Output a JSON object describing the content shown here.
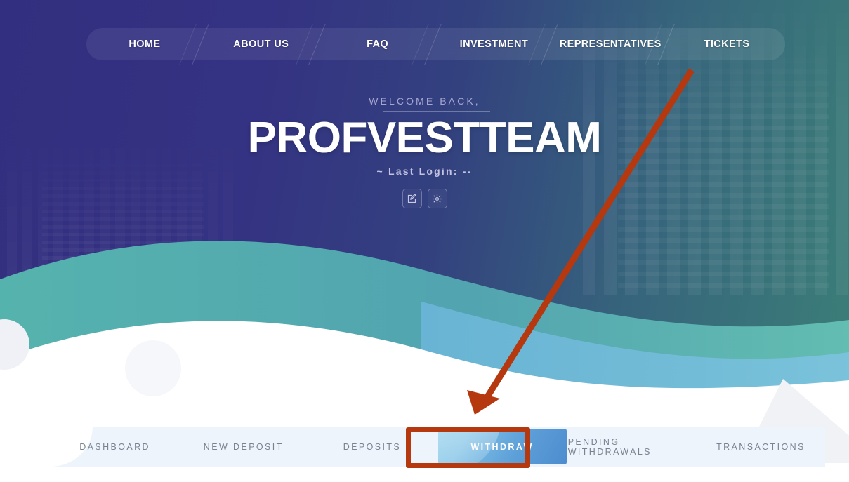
{
  "nav": {
    "items": [
      {
        "label": "HOME",
        "name": "nav-item-home"
      },
      {
        "label": "ABOUT US",
        "name": "nav-item-about-us"
      },
      {
        "label": "FAQ",
        "name": "nav-item-faq"
      },
      {
        "label": "INVESTMENT",
        "name": "nav-item-investment"
      },
      {
        "label": "REPRESENTATIVES",
        "name": "nav-item-representatives"
      },
      {
        "label": "TICKETS",
        "name": "nav-item-tickets"
      }
    ]
  },
  "hero": {
    "welcome": "WELCOME BACK,",
    "username": "PROFVESTTEAM",
    "last_login": "~ Last Login: --",
    "actions": [
      {
        "name": "edit-profile-icon",
        "icon": "edit-square-icon"
      },
      {
        "name": "settings-icon",
        "icon": "gear-icon"
      }
    ]
  },
  "tabs": {
    "items": [
      {
        "label": "DASHBOARD",
        "active": false
      },
      {
        "label": "NEW DEPOSIT",
        "active": false
      },
      {
        "label": "DEPOSITS",
        "active": false
      },
      {
        "label": "WITHDRAW",
        "active": true
      },
      {
        "label": "PENDING WITHDRAWALS",
        "active": false
      },
      {
        "label": "TRANSACTIONS",
        "active": false
      }
    ],
    "active_label": "WITHDRAW"
  },
  "annotation": {
    "color": "#b5380f",
    "highlight_target": "WITHDRAW",
    "arrow_from": "985,100",
    "arrow_to": "676,591"
  },
  "colors": {
    "hero_start": "#332f80",
    "hero_end": "#3b7d78",
    "nav_text": "#ffffff",
    "tabbar_bg": "#eef4fb",
    "tab_text": "#7b8390",
    "active_tab_start": "#7fc6e8",
    "active_tab_end": "#4d8ccf",
    "annotation": "#b5380f"
  }
}
